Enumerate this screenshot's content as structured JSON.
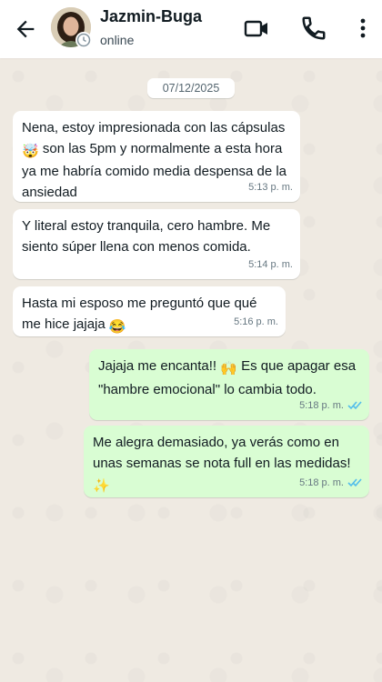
{
  "header": {
    "contact_name": "Jazmin-Buga",
    "status": "online"
  },
  "chat": {
    "date": "07/12/2025",
    "messages": [
      {
        "direction": "in",
        "text": "Nena, estoy impresionada con las cápsulas",
        "emoji1": "🤯",
        "text2": " son las 5pm y normalmente a esta hora ya me habría comido media despensa de la ansiedad",
        "time": "5:13 p. m."
      },
      {
        "direction": "in",
        "text": "Y literal estoy tranquila, cero hambre. Me siento súper llena con menos comida.",
        "time": "5:14 p. m."
      },
      {
        "direction": "in",
        "text": "Hasta mi esposo me preguntó que qué me hice jajaja",
        "emoji1": "😂",
        "time": "5:16 p. m."
      },
      {
        "direction": "out",
        "text": "Jajaja me encanta!!",
        "emoji1": "🙌",
        "text2": " Es que apagar esa \"hambre emocional\" lo cambia todo.",
        "time": "5:18 p. m.",
        "read": true
      },
      {
        "direction": "out",
        "text": "Me alegra demasiado, ya verás como en unas semanas se nota full en las medidas!",
        "emoji1": "✨",
        "time": "5:18 p. m.",
        "read": true
      }
    ]
  },
  "colors": {
    "incoming_bubble": "#ffffff",
    "outgoing_bubble": "#d9fdd3",
    "read_tick": "#53bdeb",
    "chat_background": "#efeae2"
  },
  "icons": [
    "back-arrow-icon",
    "avatar",
    "video-call-icon",
    "phone-icon",
    "more-vertical-icon",
    "double-check-icon"
  ]
}
